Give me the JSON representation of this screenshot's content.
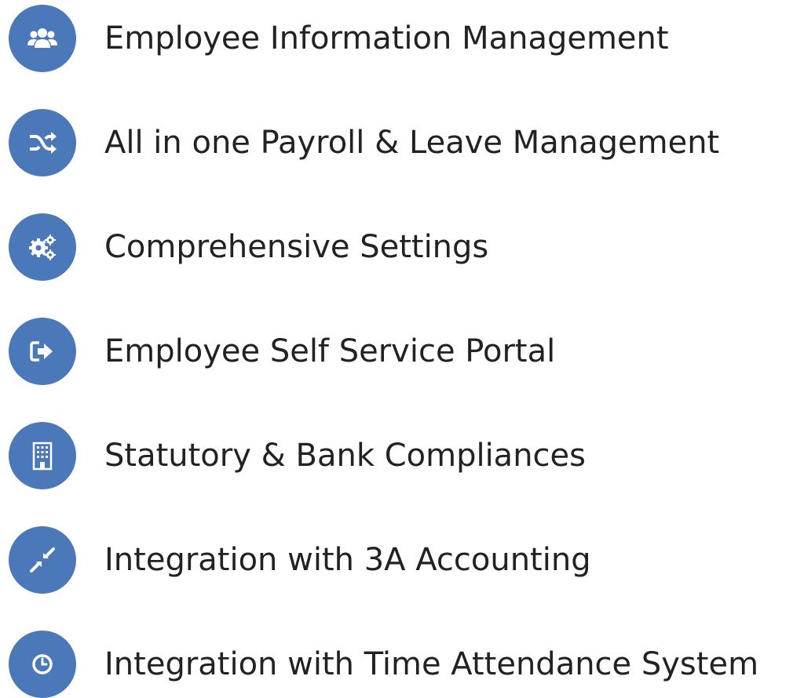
{
  "accent_color": "#4a78b8",
  "text_color": "#222222",
  "features": [
    {
      "icon": "users-icon",
      "label": "Employee Information Management"
    },
    {
      "icon": "shuffle-icon",
      "label": "All in one Payroll & Leave Management"
    },
    {
      "icon": "gears-icon",
      "label": "Comprehensive Settings"
    },
    {
      "icon": "sign-in-icon",
      "label": "Employee Self Service Portal"
    },
    {
      "icon": "building-icon",
      "label": "Statutory & Bank Compliances"
    },
    {
      "icon": "compress-icon",
      "label": "Integration with 3A Accounting"
    },
    {
      "icon": "clock-icon",
      "label": "Integration with Time Attendance System"
    }
  ]
}
